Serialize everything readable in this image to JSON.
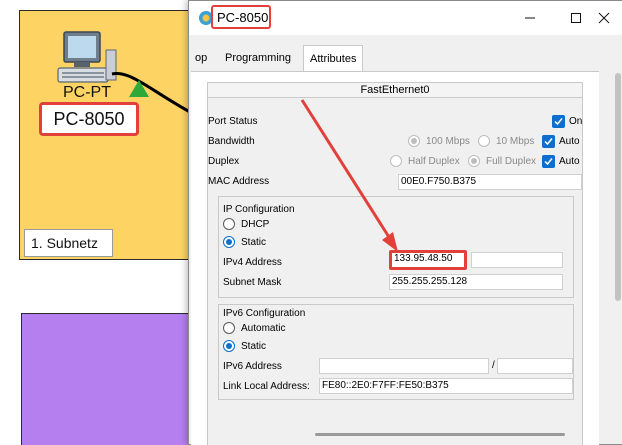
{
  "workspace": {
    "device_type": "PC-PT",
    "device_name": "PC-8050",
    "subnet_label": "1. Subnetz",
    "colors": {
      "subnet1": "#fdd464",
      "subnet2": "#b57ff0",
      "highlight": "#e2413b"
    }
  },
  "window": {
    "title": "PC-8050",
    "controls": {
      "minimize": "minimize-icon",
      "maximize": "maximize-icon",
      "close": "close-icon"
    }
  },
  "tabs": [
    {
      "label": "op"
    },
    {
      "label": "Programming"
    },
    {
      "label": "Attributes"
    }
  ],
  "interface": {
    "name": "FastEthernet0",
    "port_status": {
      "label": "Port Status",
      "on_label": "On",
      "checked": true
    },
    "bandwidth": {
      "label": "Bandwidth",
      "opt1": "100 Mbps",
      "opt2": "10 Mbps",
      "auto_label": "Auto",
      "auto_checked": true
    },
    "duplex": {
      "label": "Duplex",
      "opt1": "Half Duplex",
      "opt2": "Full Duplex",
      "auto_label": "Auto",
      "auto_checked": true
    },
    "mac": {
      "label": "MAC Address",
      "value": "00E0.F750.B375"
    }
  },
  "ip_config": {
    "title": "IP Configuration",
    "dhcp_label": "DHCP",
    "static_label": "Static",
    "selected": "Static",
    "ipv4_label": "IPv4 Address",
    "ipv4_value": "133.95.48.50",
    "mask_label": "Subnet Mask",
    "mask_value": "255.255.255.128"
  },
  "ipv6_config": {
    "title": "IPv6 Configuration",
    "auto_label": "Automatic",
    "static_label": "Static",
    "selected": "Static",
    "ipv6_label": "IPv6 Address",
    "ipv6_value": "",
    "prefix_sep": "/",
    "prefix_value": "",
    "link_local_label": "Link Local Address:",
    "link_local_value": "FE80::2E0:F7FF:FE50:B375"
  }
}
